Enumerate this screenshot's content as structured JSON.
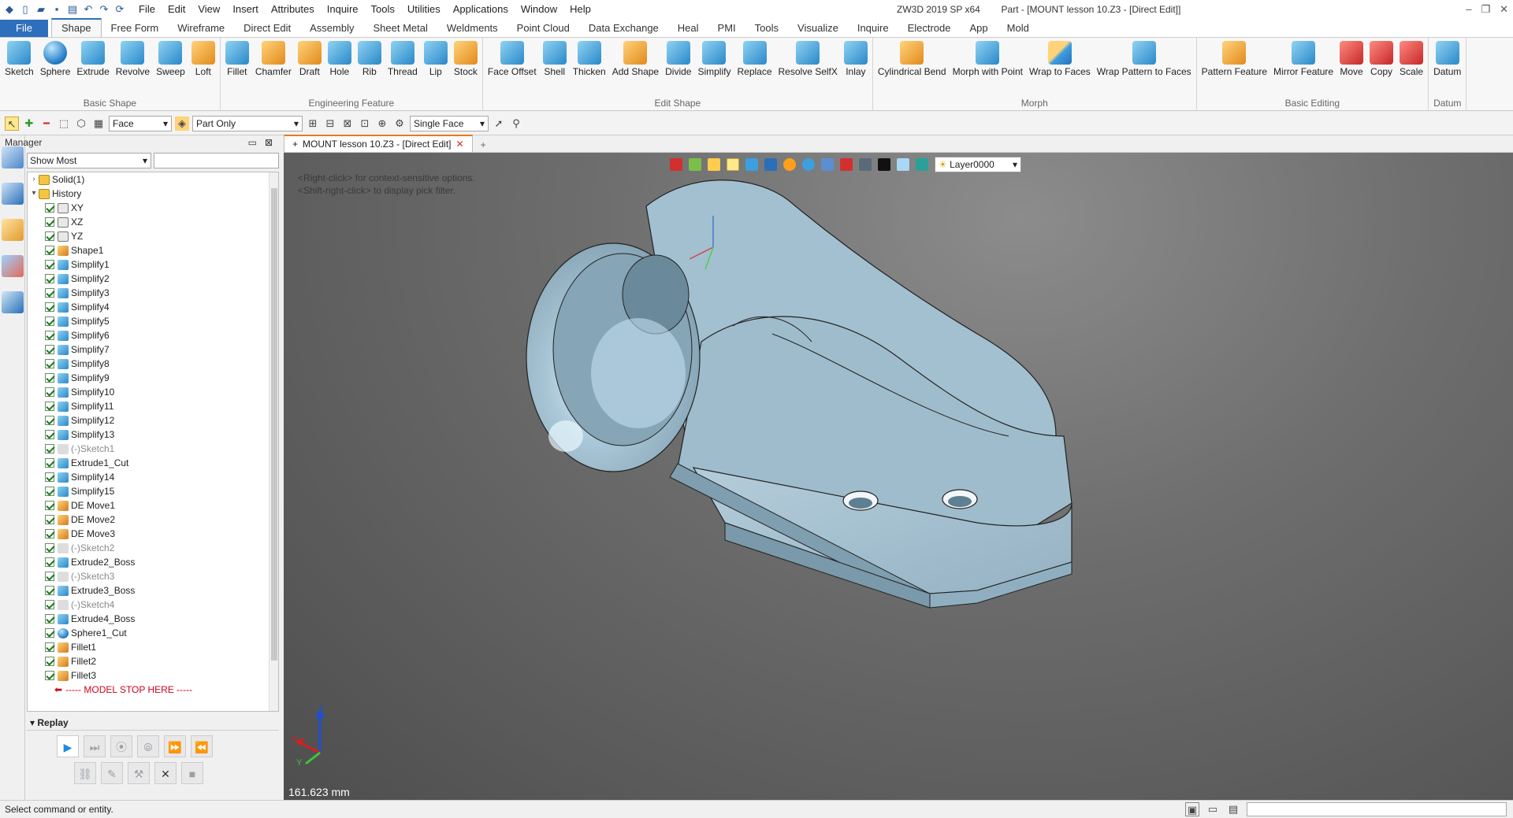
{
  "titlebar": {
    "menus": [
      "File",
      "Edit",
      "View",
      "Insert",
      "Attributes",
      "Inquire",
      "Tools",
      "Utilities",
      "Applications",
      "Window",
      "Help"
    ],
    "app_title": "ZW3D 2019 SP x64",
    "doc_title": "Part - [MOUNT lesson 10.Z3 - [Direct Edit]]"
  },
  "tabs": [
    "File",
    "Shape",
    "Free Form",
    "Wireframe",
    "Direct Edit",
    "Assembly",
    "Sheet Metal",
    "Weldments",
    "Point Cloud",
    "Data Exchange",
    "Heal",
    "PMI",
    "Tools",
    "Visualize",
    "Inquire",
    "Electrode",
    "App",
    "Mold"
  ],
  "ribbon": {
    "basic_shape": {
      "title": "Basic Shape",
      "buttons": [
        "Sketch",
        "Sphere",
        "Extrude",
        "Revolve",
        "Sweep",
        "Loft"
      ]
    },
    "engineering": {
      "title": "Engineering Feature",
      "buttons": [
        "Fillet",
        "Chamfer",
        "Draft",
        "Hole",
        "Rib",
        "Thread",
        "Lip",
        "Stock"
      ]
    },
    "edit_shape": {
      "title": "Edit Shape",
      "buttons": [
        "Face Offset",
        "Shell",
        "Thicken",
        "Add Shape",
        "Divide",
        "Simplify",
        "Replace",
        "Resolve SelfX",
        "Inlay"
      ]
    },
    "morph": {
      "title": "Morph",
      "buttons": [
        "Cylindrical Bend",
        "Morph with Point",
        "Wrap to Faces",
        "Wrap Pattern to Faces"
      ]
    },
    "basic_editing": {
      "title": "Basic Editing",
      "buttons": [
        "Pattern Feature",
        "Mirror Feature",
        "Move",
        "Copy",
        "Scale"
      ]
    },
    "datum": {
      "title": "Datum",
      "buttons": [
        "Datum"
      ]
    }
  },
  "toolbar2": {
    "filter": "Face",
    "scope": "Part Only",
    "pick": "Single Face"
  },
  "manager": {
    "title": "Manager",
    "filter": "Show Most",
    "tree": [
      {
        "label": "Solid(1)",
        "icon": "folder",
        "level": 0,
        "exp": ">"
      },
      {
        "label": "History",
        "icon": "folder",
        "level": 0,
        "exp": "v"
      },
      {
        "label": "XY",
        "icon": "plane",
        "level": 1
      },
      {
        "label": "XZ",
        "icon": "plane",
        "level": 1
      },
      {
        "label": "YZ",
        "icon": "plane",
        "level": 1
      },
      {
        "label": "Shape1",
        "icon": "gold",
        "level": 1
      },
      {
        "label": "Simplify1",
        "icon": "cube",
        "level": 1
      },
      {
        "label": "Simplify2",
        "icon": "cube",
        "level": 1
      },
      {
        "label": "Simplify3",
        "icon": "cube",
        "level": 1
      },
      {
        "label": "Simplify4",
        "icon": "cube",
        "level": 1
      },
      {
        "label": "Simplify5",
        "icon": "cube",
        "level": 1
      },
      {
        "label": "Simplify6",
        "icon": "cube",
        "level": 1
      },
      {
        "label": "Simplify7",
        "icon": "cube",
        "level": 1
      },
      {
        "label": "Simplify8",
        "icon": "cube",
        "level": 1
      },
      {
        "label": "Simplify9",
        "icon": "cube",
        "level": 1
      },
      {
        "label": "Simplify10",
        "icon": "cube",
        "level": 1
      },
      {
        "label": "Simplify11",
        "icon": "cube",
        "level": 1
      },
      {
        "label": "Simplify12",
        "icon": "cube",
        "level": 1
      },
      {
        "label": "Simplify13",
        "icon": "cube",
        "level": 1
      },
      {
        "label": "(-)Sketch1",
        "icon": "sketch",
        "level": 1,
        "dim": true
      },
      {
        "label": "Extrude1_Cut",
        "icon": "cube",
        "level": 1
      },
      {
        "label": "Simplify14",
        "icon": "cube",
        "level": 1
      },
      {
        "label": "Simplify15",
        "icon": "cube",
        "level": 1
      },
      {
        "label": "DE Move1",
        "icon": "gold",
        "level": 1
      },
      {
        "label": "DE Move2",
        "icon": "gold",
        "level": 1
      },
      {
        "label": "DE Move3",
        "icon": "gold",
        "level": 1
      },
      {
        "label": "(-)Sketch2",
        "icon": "sketch",
        "level": 1,
        "dim": true
      },
      {
        "label": "Extrude2_Boss",
        "icon": "cube",
        "level": 1
      },
      {
        "label": "(-)Sketch3",
        "icon": "sketch",
        "level": 1,
        "dim": true
      },
      {
        "label": "Extrude3_Boss",
        "icon": "cube",
        "level": 1
      },
      {
        "label": "(-)Sketch4",
        "icon": "sketch",
        "level": 1,
        "dim": true
      },
      {
        "label": "Extrude4_Boss",
        "icon": "cube",
        "level": 1
      },
      {
        "label": "Sphere1_Cut",
        "icon": "ball",
        "level": 1
      },
      {
        "label": "Fillet1",
        "icon": "gold",
        "level": 1
      },
      {
        "label": "Fillet2",
        "icon": "gold",
        "level": 1
      },
      {
        "label": "Fillet3",
        "icon": "gold",
        "level": 1
      }
    ],
    "stop_label": "----- MODEL STOP HERE -----"
  },
  "replay": {
    "title": "Replay"
  },
  "doc_tab": "MOUNT lesson 10.Z3 - [Direct Edit]",
  "viewport": {
    "hint1": "<Right-click> for context-sensitive options.",
    "hint2": "<Shift-right-click> to display pick filter.",
    "layer": "Layer0000",
    "measure": "161.623 mm"
  },
  "status": {
    "text": "Select command or entity."
  },
  "colors": {
    "accent": "#2e6fbd",
    "part": "#a8c4d4",
    "viewport_bg": "#6e6e6e"
  }
}
